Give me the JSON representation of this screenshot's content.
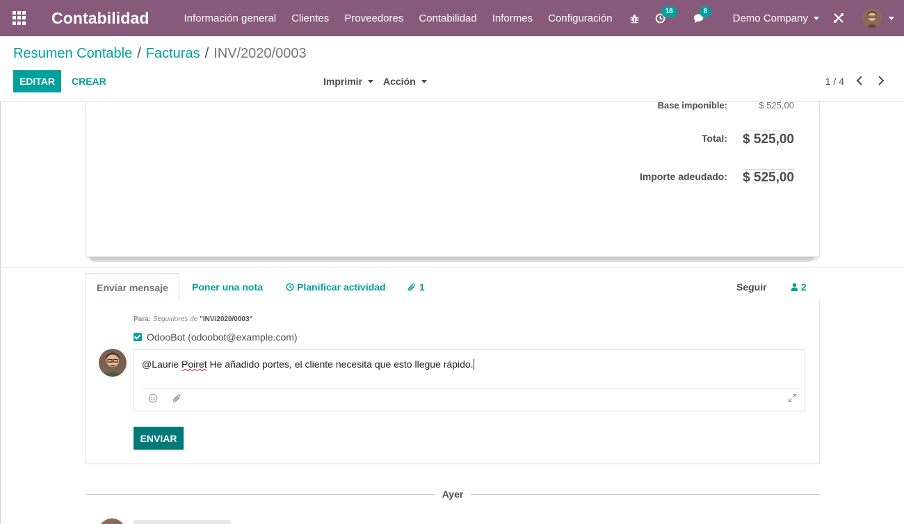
{
  "app": {
    "brand": "Contabilidad",
    "menu": [
      "Información general",
      "Clientes",
      "Proveedores",
      "Contabilidad",
      "Informes",
      "Configuración"
    ],
    "activity_count": "18",
    "message_count": "6",
    "company": "Demo Company"
  },
  "breadcrumb": {
    "items": [
      "Resumen Contable",
      "Facturas"
    ],
    "current": "INV/2020/0003",
    "separator": "/"
  },
  "toolbar": {
    "edit_label": "EDITAR",
    "create_label": "CREAR",
    "print_label": "Imprimir",
    "action_label": "Acción",
    "pager": "1 / 4"
  },
  "totals": {
    "base_label": "Base imponible:",
    "base_value": "$ 525,00",
    "total_label": "Total:",
    "total_value": "$ 525,00",
    "due_label": "Importe adeudado:",
    "due_value": "$ 525,00"
  },
  "chatter": {
    "tabs": {
      "send_message": "Enviar mensaje",
      "log_note": "Poner una nota",
      "schedule_activity": "Planificar actividad",
      "attachments": "1",
      "follow": "Seguir",
      "followers": "2"
    },
    "recipients": {
      "prefix": "Para:",
      "followers_of": "Seguidores de",
      "document": "\"INV/2020/0003\""
    },
    "recipient_checkbox": "OdooBot (odoobot@example.com)",
    "message": {
      "mention": "@Laurie ",
      "misspelled": "Poiret",
      "rest": " He añadido portes, el cliente necesita que esto llegue rápido."
    },
    "send_label": "ENVIAR",
    "day_separator": "Ayer"
  },
  "colors": {
    "navbar": "#875a7b",
    "primary": "#00a09d",
    "send_button": "#007a77"
  }
}
